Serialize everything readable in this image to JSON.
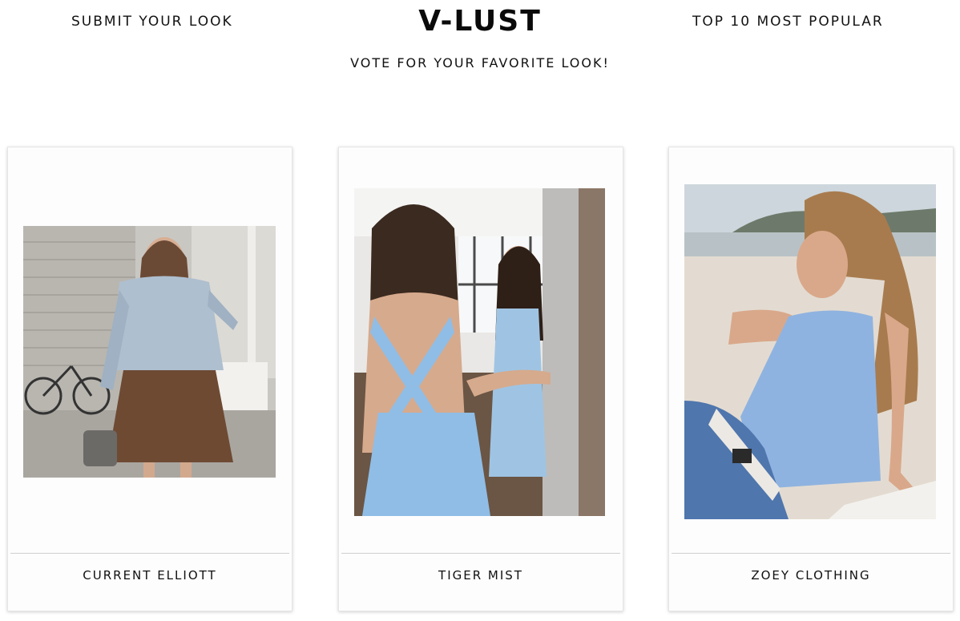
{
  "header": {
    "submit_link": "SUBMIT YOUR LOOK",
    "brand": "V-LUST",
    "popular_link": "TOP 10 MOST POPULAR",
    "tagline": "VOTE FOR YOUR FAVORITE LOOK!"
  },
  "looks": [
    {
      "brand_name": "CURRENT ELLIOTT"
    },
    {
      "brand_name": "TIGER MIST"
    },
    {
      "brand_name": "ZOEY CLOTHING"
    }
  ]
}
